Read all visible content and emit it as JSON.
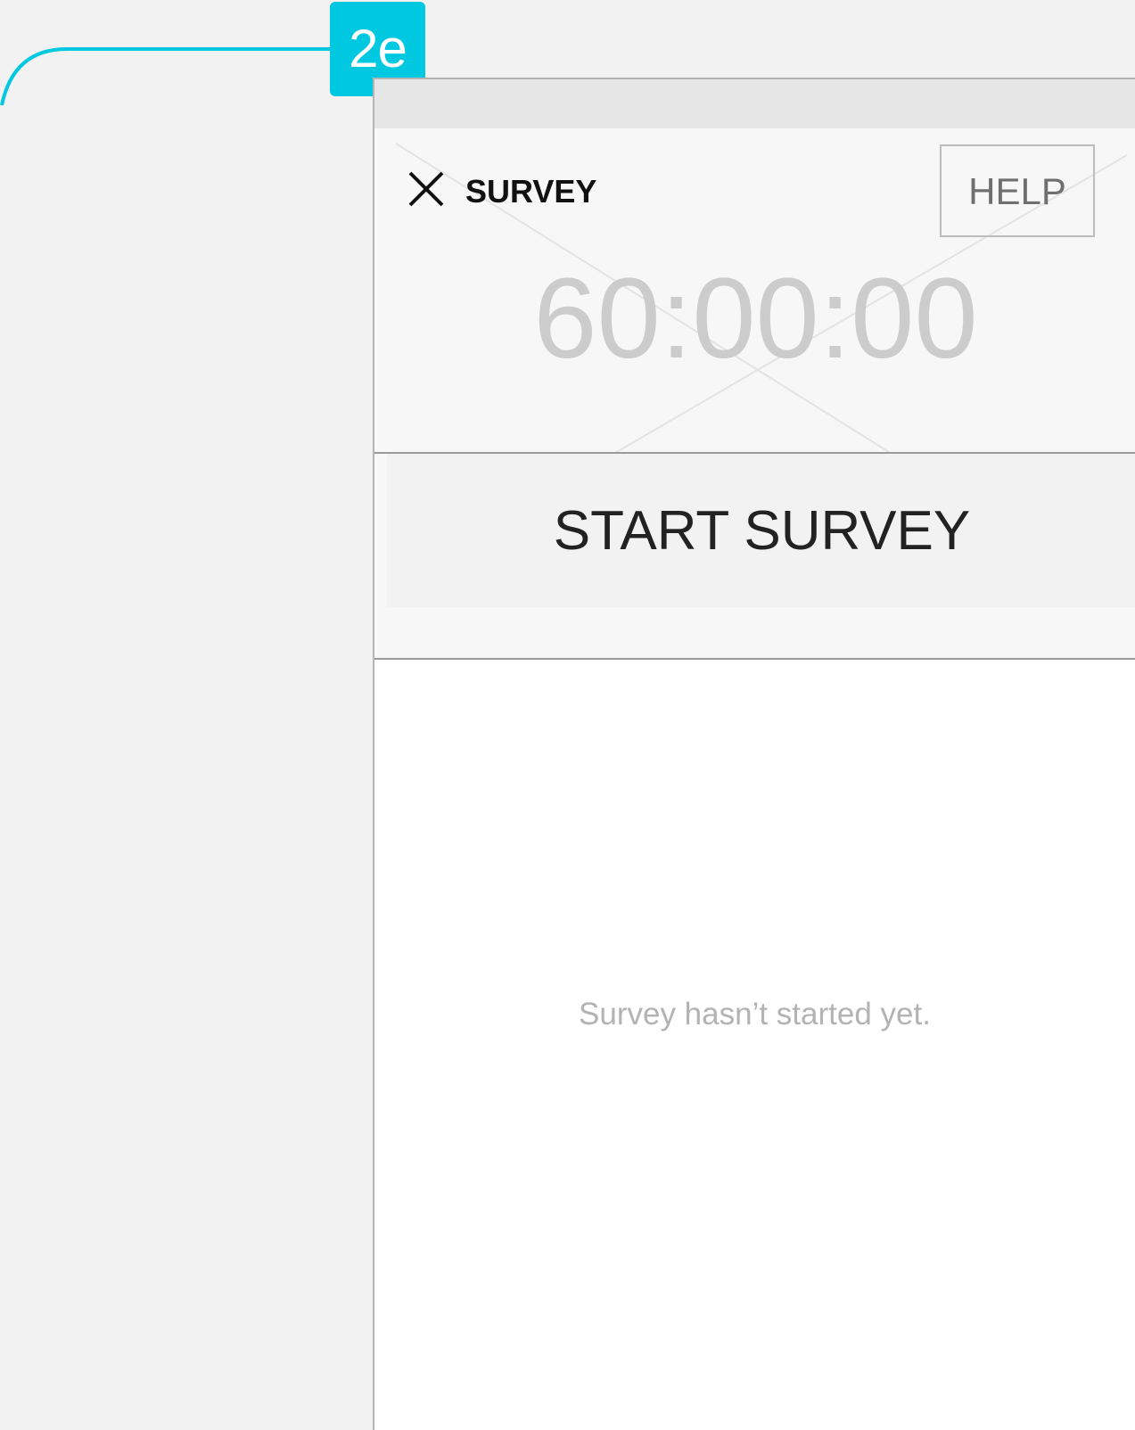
{
  "annotation": {
    "badge_label": "2e",
    "accent_color": "#00c8e0"
  },
  "header": {
    "close_icon": "close-icon",
    "title": "SURVEY",
    "help_label": "HELP"
  },
  "timer": {
    "value": "60:00:00"
  },
  "actions": {
    "start_label": "START SURVEY"
  },
  "content": {
    "empty_message": "Survey hasn’t started yet."
  }
}
